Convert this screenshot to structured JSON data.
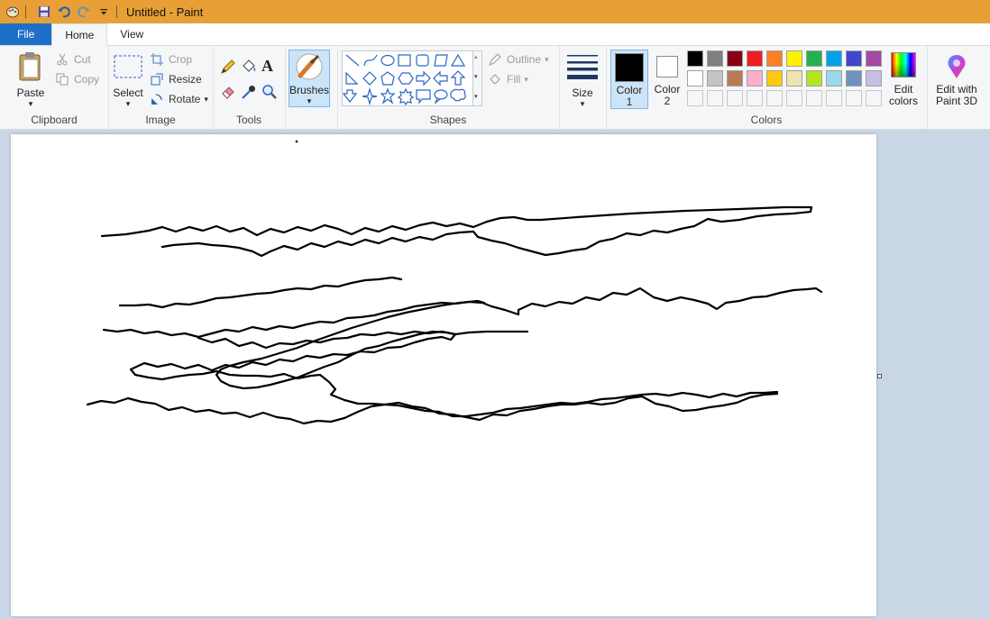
{
  "window": {
    "title": "Untitled - Paint"
  },
  "tabs": [
    {
      "label": "File"
    },
    {
      "label": "Home"
    },
    {
      "label": "View"
    }
  ],
  "clipboard": {
    "paste": "Paste",
    "cut": "Cut",
    "copy": "Copy",
    "group": "Clipboard"
  },
  "image": {
    "select": "Select",
    "crop": "Crop",
    "resize": "Resize",
    "rotate": "Rotate",
    "group": "Image"
  },
  "tools": {
    "group": "Tools"
  },
  "brushes": {
    "label": "Brushes"
  },
  "shapes": {
    "outline": "Outline",
    "fill": "Fill",
    "group": "Shapes"
  },
  "size": {
    "label": "Size"
  },
  "colors": {
    "color1_line1": "Color",
    "color1_line2": "1",
    "color2_line1": "Color",
    "color2_line2": "2",
    "edit_line1": "Edit",
    "edit_line2": "colors",
    "group": "Colors",
    "color1": "#000000",
    "color2": "#ffffff",
    "palette_row1": [
      "#000000",
      "#7f7f7f",
      "#880015",
      "#ed1c24",
      "#ff7f27",
      "#fff200",
      "#22b14c",
      "#00a2e8",
      "#3f48cc",
      "#a349a4"
    ],
    "palette_row2": [
      "#ffffff",
      "#c3c3c3",
      "#b97a57",
      "#ffaec9",
      "#ffc90e",
      "#efe4b0",
      "#b5e61d",
      "#99d9ea",
      "#7092be",
      "#c8bfe7"
    ]
  },
  "paint3d": {
    "line1": "Edit with",
    "line2": "Paint 3D"
  }
}
